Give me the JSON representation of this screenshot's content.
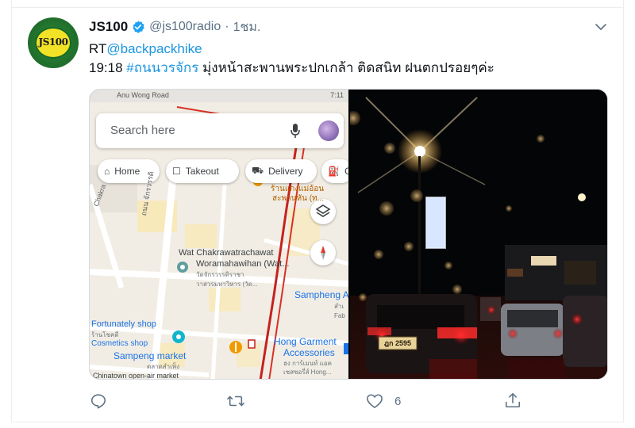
{
  "tweet": {
    "display_name": "JS100",
    "handle": "@js100radio",
    "separator": "·",
    "time": "1ชม.",
    "avatar_logo": "JS100",
    "rt_prefix": "RT",
    "rt_mention": "@backpackhike",
    "line2_time": "19:18",
    "line2_hashtag": "#ถนนวรจักร",
    "line2_text": "มุ่งหน้าสะพานพระปกเกล้า ติดสนิท ฝนตกปรอยๆค่ะ"
  },
  "map_screenshot": {
    "status_left": "Anu Wong Road",
    "status_right": "7:11",
    "search_placeholder": "Search here",
    "chips": {
      "home": "Home",
      "takeout": "Takeout",
      "delivery": "Delivery",
      "gas": "G"
    },
    "labels": {
      "wat_line1": "Wat Chakrawatrachawat",
      "wat_line2": "Woramahawihan (Wat...",
      "wat_th1": "วัดจักรวรรดิราชา",
      "wat_th2": "วาสวรมหาวิหาร (วัด...",
      "shop_th1": "ร้านแกงแม่อ้อน",
      "shop_th2": "สะพานหัน (ท...",
      "sampheng": "Sampheng A",
      "sampheng_th": "สำเ",
      "sampheng_fab": "Fab",
      "fortunately": "Fortunately shop",
      "fortunately_th": "ร้านโชคดี",
      "cosmetics": "Cosmetics shop",
      "hong_line1": "Hong Garment",
      "hong_line2": "Accessories",
      "hong_th1": "ฮง การ์เมนท์ แอค",
      "hong_th2": "เซสซอรี่ส์ Hong...",
      "sampeng_market": "Sampeng market",
      "sampeng_market_th": "ตลาดสำเพ็ง",
      "chinatown": "Chinatown open-air market",
      "road_vertical": "ถนน จักรวรรดิ",
      "road_left": "Chakra"
    }
  },
  "photo": {
    "plate": "ฎก 2595"
  },
  "actions": {
    "like_count": "6"
  },
  "colors": {
    "link": "#1b95e0",
    "muted": "#5b7083",
    "verified": "#1da1f2",
    "border": "#ebeef0"
  },
  "icons": [
    "verified-badge-icon",
    "chevron-down-icon",
    "reply-icon",
    "retweet-icon",
    "like-icon",
    "share-icon",
    "mic-icon",
    "home-icon",
    "takeout-icon",
    "delivery-icon",
    "gas-icon",
    "layers-icon",
    "compass-icon"
  ]
}
